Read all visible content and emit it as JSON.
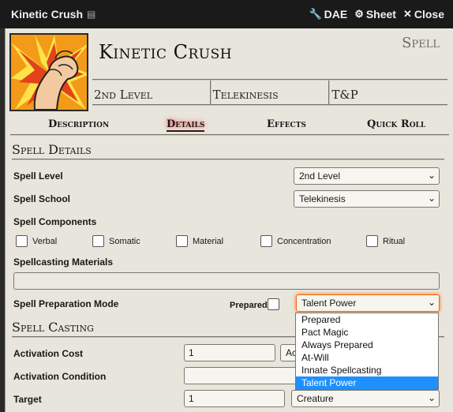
{
  "window": {
    "title": "Kinetic Crush",
    "dae_label": "DAE",
    "sheet_label": "Sheet",
    "close_label": "Close"
  },
  "header": {
    "name": "Kinetic Crush",
    "item_type": "Spell",
    "summary": [
      "2nd Level",
      "Telekinesis",
      "T&P"
    ]
  },
  "tabs": [
    "Description",
    "Details",
    "Effects",
    "Quick Roll"
  ],
  "details": {
    "section_title": "Spell Details",
    "spell_level_label": "Spell Level",
    "spell_level_value": "2nd Level",
    "spell_school_label": "Spell School",
    "spell_school_value": "Telekinesis",
    "components_label": "Spell Components",
    "components": [
      "Verbal",
      "Somatic",
      "Material",
      "Concentration",
      "Ritual"
    ],
    "materials_label": "Spellcasting Materials",
    "materials_value": "",
    "prep_mode_label": "Spell Preparation Mode",
    "prepared_label": "Prepared",
    "prep_mode_value": "Talent Power",
    "prep_mode_options": [
      "Prepared",
      "Pact Magic",
      "Always Prepared",
      "At-Will",
      "Innate Spellcasting",
      "Talent Power"
    ]
  },
  "casting": {
    "section_title": "Spell Casting",
    "activation_cost_label": "Activation Cost",
    "activation_cost_value": "1",
    "activation_type_value": "Ac",
    "activation_condition_label": "Activation Condition",
    "activation_condition_value": "",
    "target_label": "Target",
    "target_value": "1",
    "target_type_value": "Creature"
  },
  "colors": {
    "accent_glow": "#ff3030",
    "selected_option": "#1e90ff",
    "parchment": "#e8e5dc"
  }
}
